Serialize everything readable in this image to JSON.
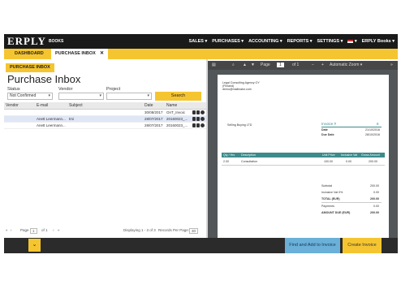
{
  "topbar": {
    "logo": "ERPLY",
    "logo_sub": "BOOKS",
    "nav": [
      "SALES ▾",
      "PURCHASES ▾",
      "ACCOUNTING ▾",
      "REPORTS ▾",
      "SETTINGS ▾"
    ],
    "flag_caret": "▾",
    "account": "ERPLY Books ▾"
  },
  "tabs": {
    "dashboard": "DASHBOARD",
    "inbox": "PURCHASE INBOX",
    "close": "✕"
  },
  "subtab": "PURCHASE INBOX",
  "page_title": "Purchase Inbox",
  "filters": {
    "status_label": "Status",
    "status_value": "Not Confirmed",
    "vendor_label": "Vendor",
    "vendor_value": "",
    "project_label": "Project",
    "project_value": "",
    "caret": "▾",
    "search": "Search"
  },
  "grid": {
    "columns": [
      "Vendor",
      "E-mail",
      "Subject",
      "Date",
      "Name"
    ],
    "rows": [
      {
        "vendor": "",
        "email": "",
        "subject": "",
        "date": "30/08/2017",
        "name": "OnT_Invoic"
      },
      {
        "vendor": "",
        "email": "Anett Leermann...",
        "subject": "tmi",
        "date": "28/07/2017",
        "name": "20160023_..."
      },
      {
        "vendor": "",
        "email": "Anett Leermann...",
        "subject": "",
        "date": "28/07/2017",
        "name": "20160023_..."
      }
    ]
  },
  "pager": {
    "first": "«",
    "prev": "‹",
    "page_label": "Page",
    "page_value": "1",
    "of_label": "of 1",
    "next": "›",
    "last": "»",
    "displaying": "Displaying 1 - 3 of 3",
    "per_page_label": "Records Per Page:",
    "per_page_value": "30"
  },
  "pdf": {
    "sidebar_icon": "▤",
    "search_icon": "⌕",
    "up": "▲",
    "down": "▼",
    "page_label": "Page",
    "page_value": "1",
    "of_label": "of 1",
    "zoom_out": "−",
    "zoom_in": "+",
    "zoom_value": "Automatic Zoom ▾",
    "more": "»",
    "company": "Legal Consulting Agency OY",
    "company_city": "(Finland)",
    "company_email": "demo@mailinator.com",
    "buyer": "Selling Buying LTD",
    "invoice_label": "Invoice #",
    "invoice_no": "6",
    "date_label": "Date",
    "date_value": "21/10/2016",
    "due_label": "Due Date",
    "due_value": "28/10/2016",
    "table_cols": [
      "Qty / Hrs",
      "Description",
      "Unit Price",
      "Inclusive Vat",
      "Gross Amount"
    ],
    "line": {
      "qty": "2.00",
      "desc": "Consultation",
      "unit": "100.00",
      "vat": "0.00",
      "gross": "200.00"
    },
    "totals": [
      {
        "label": "Subtotal",
        "value": "200.00"
      },
      {
        "label": "Inclusive Vat 0%",
        "value": "0.00"
      },
      {
        "label": "TOTAL (EUR)",
        "value": "200.00"
      },
      {
        "label": "Payments",
        "value": "0.00"
      },
      {
        "label": "AMOUNT DUE (EUR)",
        "value": "200.00"
      }
    ]
  },
  "bottom": {
    "expand": "⌄",
    "find": "Find and Add to Invoice",
    "create": "Create Invoice"
  }
}
